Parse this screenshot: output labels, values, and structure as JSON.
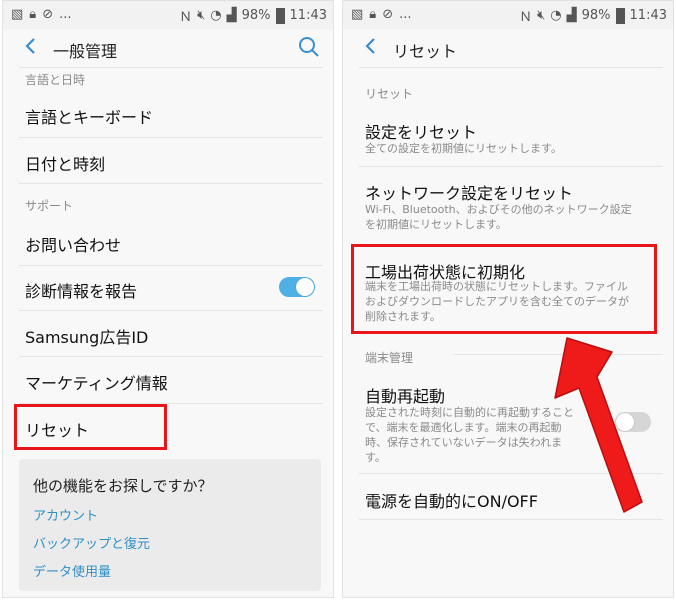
{
  "status_bar": {
    "left_icons": [
      "image-icon",
      "lock-icon",
      "block-icon",
      "more-dots-icon"
    ],
    "dots": "...",
    "battery": "98%",
    "time": "11:43"
  },
  "left": {
    "title": "一般管理",
    "section_language": "言語と日時",
    "item_language_keyboard": "言語とキーボード",
    "item_date_time": "日付と時刻",
    "section_support": "サポート",
    "item_contact": "お問い合わせ",
    "item_diagnostics": "診断情報を報告",
    "diagnostics_toggle_on": true,
    "item_samsung_ad": "Samsung広告ID",
    "item_marketing": "マーケティング情報",
    "item_reset": "リセット",
    "card_title": "他の機能をお探しですか？",
    "card_links": [
      "アカウント",
      "バックアップと復元",
      "データ使用量"
    ]
  },
  "right": {
    "title": "リセット",
    "section_reset": "リセット",
    "item_reset_settings": "設定をリセット",
    "item_reset_settings_sub": "全ての設定を初期値にリセットします。",
    "item_network_reset": "ネットワーク設定をリセット",
    "item_network_reset_sub1": "Wi-Fi、Bluetooth、およびその他のネットワーク設定",
    "item_network_reset_sub2": "を初期値にリセットします。",
    "item_factory_reset": "工場出荷状態に初期化",
    "item_factory_reset_sub1": "端末を工場出荷時の状態にリセットします。ファイル",
    "item_factory_reset_sub2": "およびダウンロードしたアプリを含む全てのデータが",
    "item_factory_reset_sub3": "削除されます。",
    "section_device": "端末管理",
    "item_auto_restart": "自動再起動",
    "item_auto_restart_sub1": "設定された時刻に自動的に再起動すること",
    "item_auto_restart_sub2": "で、端末を最適化します。端末の再起動",
    "item_auto_restart_sub3": "時、保存されていないデータは失われま",
    "item_auto_restart_sub4": "す。",
    "auto_restart_toggle_on": false,
    "item_auto_power": "電源を自動的にON/OFF"
  },
  "colors": {
    "toggle_on": "#4fb0e6",
    "toggle_off": "#d6d6d6",
    "highlight": "#e8151b",
    "link": "#2e8fc7",
    "back_arrow": "#3a8ecf"
  }
}
